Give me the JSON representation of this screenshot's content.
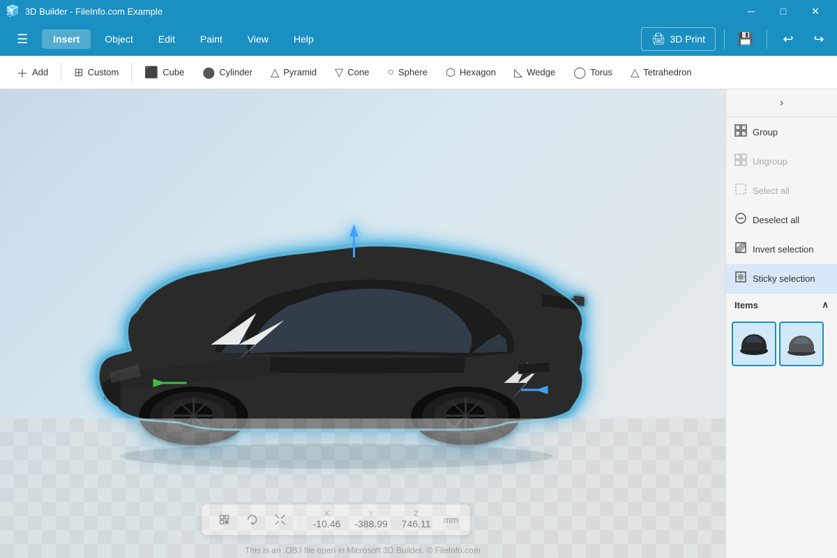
{
  "titlebar": {
    "title": "3D Builder - FileInfo.com Example",
    "min": "─",
    "max": "□",
    "close": "✕"
  },
  "menubar": {
    "hamburger": "☰",
    "items": [
      {
        "label": "Insert",
        "active": true
      },
      {
        "label": "Object",
        "active": false
      },
      {
        "label": "Edit",
        "active": false
      },
      {
        "label": "Paint",
        "active": false
      },
      {
        "label": "View",
        "active": false
      },
      {
        "label": "Help",
        "active": false
      }
    ],
    "print": "3D Print",
    "save_icon": "💾",
    "undo_icon": "↩",
    "redo_icon": "↪"
  },
  "toolbar": {
    "add": "Add",
    "custom": "Custom",
    "cube": "Cube",
    "cylinder": "Cylinder",
    "pyramid": "Pyramid",
    "cone": "Cone",
    "sphere": "Sphere",
    "hexagon": "Hexagon",
    "wedge": "Wedge",
    "torus": "Torus",
    "tetrahedron": "Tetrahedron"
  },
  "rightpanel": {
    "group": "Group",
    "ungroup": "Ungroup",
    "select_all": "Select all",
    "deselect_all": "Deselect all",
    "invert_selection": "Invert selection",
    "sticky_selection": "Sticky selection",
    "items_label": "Items"
  },
  "coords": {
    "x_label": "X",
    "y_label": "Y",
    "z_label": "Z",
    "x_value": "-10.46",
    "y_value": "-388.99",
    "z_value": "746.11",
    "unit": "mm"
  },
  "statusbar": {
    "text": "This is an .OBJ file open in Microsoft 3D Builder. © FileInfo.com"
  }
}
